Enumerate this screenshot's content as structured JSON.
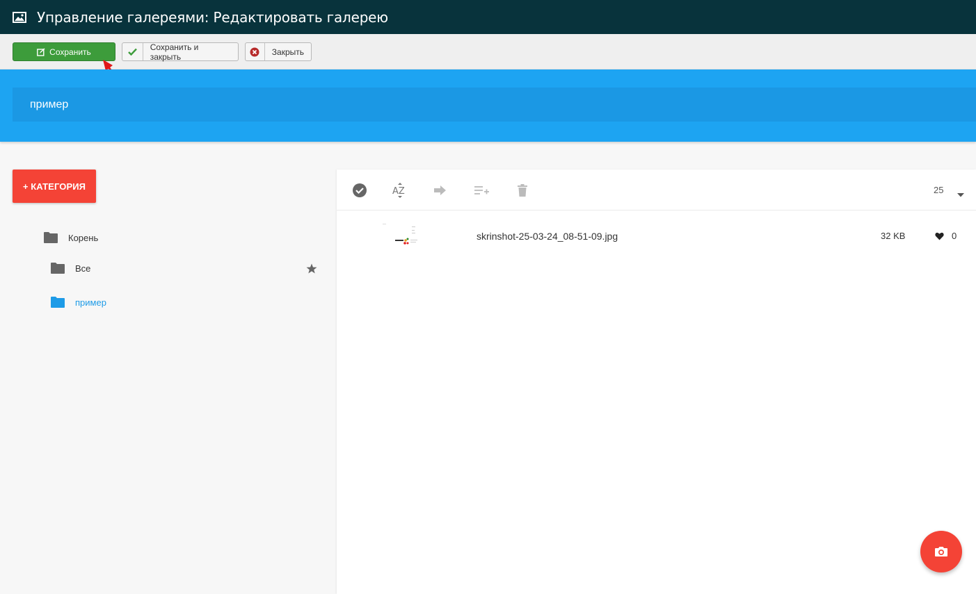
{
  "window": {
    "title": "Управление галереями: Редактировать галерею",
    "title_icon": "image-icon"
  },
  "toolbar": {
    "save_label": "Сохранить",
    "save_close_label": "Сохранить и закрыть",
    "close_label": "Закрыть"
  },
  "gallery": {
    "name": "пример"
  },
  "sidebar": {
    "add_category_label": "+ КАТЕГОРИЯ",
    "tree": [
      {
        "label": "Корень",
        "icon": "folder-icon"
      },
      {
        "label": "Все",
        "icon": "folder-icon",
        "starred": true
      },
      {
        "label": "пример",
        "icon": "folder-icon",
        "active": true
      }
    ]
  },
  "files": {
    "per_page": "25",
    "items": [
      {
        "name": "skrinshot-25-03-24_08-51-09.jpg",
        "size": "32 KB",
        "likes": "0"
      }
    ]
  },
  "colors": {
    "titlebar": "#08333c",
    "save_button": "#3d9c3b",
    "hero": "#1da4f2",
    "accent_red": "#f44336",
    "active_link": "#1e9be7"
  }
}
